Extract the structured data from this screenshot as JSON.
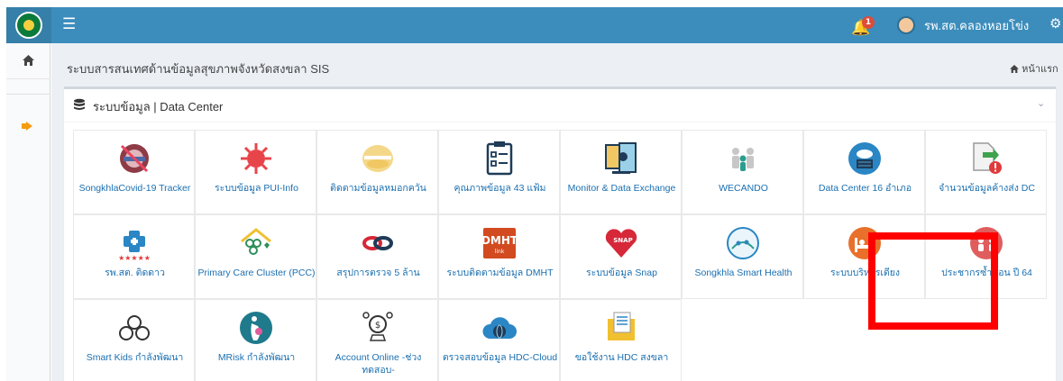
{
  "topbar": {
    "notifications_count": "1",
    "user_name": "รพ.สต.คลองหอยโข่ง"
  },
  "header": {
    "page_title": "ระบบสารสนเทศด้านข้อมูลสุขภาพจังหวัดสงขลา SIS",
    "breadcrumb_home": "หน้าแรก"
  },
  "box": {
    "title": "ระบบข้อมูล | Data Center"
  },
  "tiles": [
    {
      "label": "SongkhlaCovid-19 Tracker",
      "icon": "covid-tracker-icon"
    },
    {
      "label": "ระบบข้อมูล PUI-Info",
      "icon": "virus-icon"
    },
    {
      "label": "ติดตามข้อมูลหมอกควัน",
      "icon": "mask-icon"
    },
    {
      "label": "คุณภาพข้อมูล 43 แฟ้ม",
      "icon": "clipboard-icon"
    },
    {
      "label": "Monitor & Data Exchange",
      "icon": "data-exchange-icon"
    },
    {
      "label": "WECANDO",
      "icon": "family-icon"
    },
    {
      "label": "Data Center 16 อำเภอ",
      "icon": "cloud-server-icon"
    },
    {
      "label": "จำนวนข้อมูลค้างส่ง DC",
      "icon": "file-warning-icon"
    },
    {
      "label": "รพ.สต. ติดดาว",
      "icon": "star-clinic-icon"
    },
    {
      "label": "Primary Care Cluster (PCC)",
      "icon": "family-house-icon"
    },
    {
      "label": "สรุปการตรวจ 5 ล้าน",
      "icon": "link-icon"
    },
    {
      "label": "ระบบติดตามข้อมูล DMHT",
      "icon": "dmht-icon"
    },
    {
      "label": "ระบบข้อมูล Snap",
      "icon": "snap-heart-icon"
    },
    {
      "label": "Songkhla Smart Health",
      "icon": "smart-health-icon"
    },
    {
      "label": "ระบบบริหารเตียง",
      "icon": "bed-icon"
    },
    {
      "label": "ประชากรซ้ำซ้อน ปี 64",
      "icon": "population-icon"
    },
    {
      "label": "Smart Kids กำลังพัฒนา",
      "icon": "kids-icon"
    },
    {
      "label": "MRisk กำลังพัฒนา",
      "icon": "pregnant-icon"
    },
    {
      "label": "Account Online -ช่วงทดสอบ-",
      "icon": "money-icon"
    },
    {
      "label": "ตรวจสอบข้อมูล HDC-Cloud",
      "icon": "cloud-globe-icon"
    },
    {
      "label": "ขอใช้งาน HDC สงขลา",
      "icon": "folder-doc-icon"
    }
  ],
  "colors": {
    "topbar": "#3c8dbc",
    "highlight": "#ff0000",
    "link": "#1a6fb0"
  }
}
